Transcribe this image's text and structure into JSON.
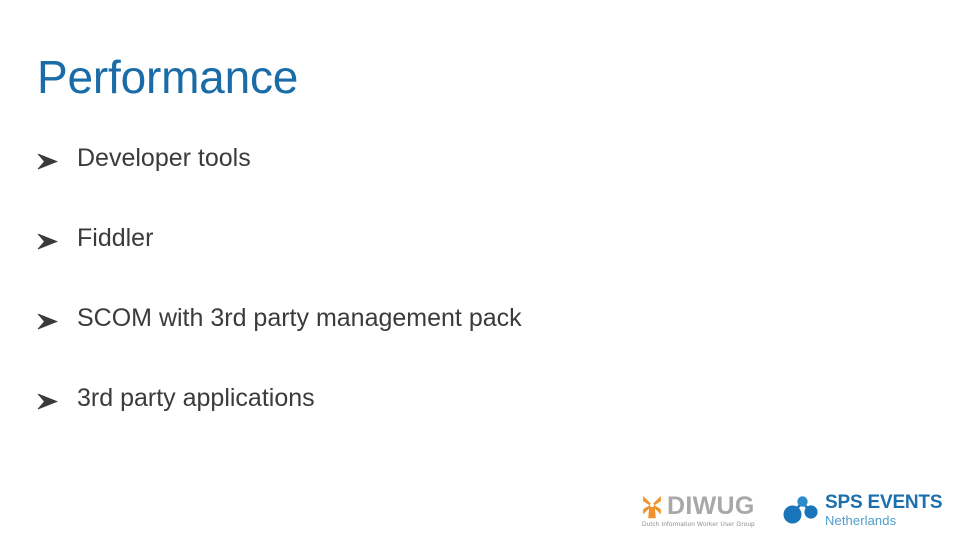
{
  "slide": {
    "title": "Performance",
    "background_color": "#FFFFFF",
    "title_color": "#1A6CA8",
    "body_text_color": "#3B3B3B",
    "bullets": [
      {
        "marker": "wingdings-arrow-bullet",
        "text": "Developer tools"
      },
      {
        "marker": "wingdings-arrow-bullet",
        "text": "Fiddler"
      },
      {
        "marker": "wingdings-arrow-bullet",
        "text": "SCOM with 3rd party management pack"
      },
      {
        "marker": "wingdings-arrow-bullet",
        "text": "3rd party applications"
      }
    ]
  },
  "footer": {
    "diwug": {
      "name": "DIWUG",
      "tagline": "Dutch Information Worker User Group",
      "mark_color": "#F0912D",
      "text_color": "#A8A8A8"
    },
    "sps": {
      "name": "SPS EVENTS",
      "subtitle": "Netherlands",
      "mark_color": "#1B75BB",
      "text_color": "#1B6FAD",
      "subtitle_color": "#4F9CCD"
    }
  }
}
